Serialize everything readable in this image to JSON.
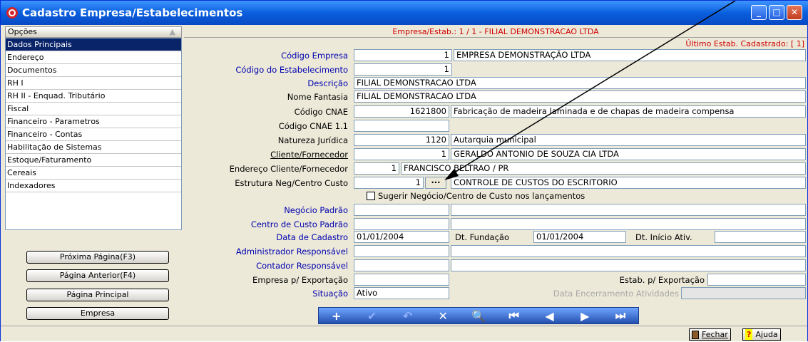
{
  "window": {
    "title": "Cadastro Empresa/Estabelecimentos",
    "min": "_",
    "max": "□",
    "close": "✕"
  },
  "sidebar": {
    "header": "Opções",
    "items": [
      {
        "label": "Dados Principais",
        "selected": true
      },
      {
        "label": "Endereço"
      },
      {
        "label": "Documentos"
      },
      {
        "label": "RH I"
      },
      {
        "label": "RH II - Enquad. Tributário"
      },
      {
        "label": "Fiscal"
      },
      {
        "label": "Financeiro - Parametros"
      },
      {
        "label": "Financeiro - Contas"
      },
      {
        "label": "Habilitação de Sistemas"
      },
      {
        "label": "Estoque/Faturamento"
      },
      {
        "label": "Cereais"
      },
      {
        "label": "Indexadores"
      }
    ],
    "buttons": {
      "next": "Próxima Página(F3)",
      "prev": "Página Anterior(F4)",
      "main": "Página Principal",
      "empresa": "Empresa"
    }
  },
  "header": {
    "title": "Empresa/Estab.: 1 / 1 - FILIAL DEMONSTRACAO LTDA",
    "ultimo": "Último Estab. Cadastrado: [ 1]"
  },
  "form": {
    "codigo_empresa": {
      "label": "Código Empresa",
      "value": "1",
      "desc": "EMPRESA DEMONSTRAÇÃO LTDA"
    },
    "codigo_estab": {
      "label": "Código do Estabelecimento",
      "value": "1"
    },
    "descricao": {
      "label": "Descrição",
      "value": "FILIAL DEMONSTRACAO LTDA"
    },
    "fantasia": {
      "label": "Nome Fantasia",
      "value": "FILIAL DEMONSTRACAO LTDA"
    },
    "cnae": {
      "label": "Código CNAE",
      "value": "1621800",
      "desc": "Fabricação de madeira laminada e de chapas de madeira compensa"
    },
    "cnae11": {
      "label": "Código CNAE 1.1",
      "value": ""
    },
    "natureza": {
      "label": "Natureza Jurídica",
      "value": "1120",
      "desc": "Autarquia municipal"
    },
    "cliente": {
      "label": "Cliente/Fornecedor",
      "value": "1",
      "desc": "GERALDO ANTONIO DE SOUZA CIA LTDA"
    },
    "endereco": {
      "label": "Endereço Cliente/Fornecedor",
      "value": "1",
      "desc": "FRANCISCO BELTRAO / PR"
    },
    "estrutura": {
      "label": "Estrutura Neg/Centro Custo",
      "value": "1",
      "btn": "···",
      "desc": "CONTROLE DE CUSTOS DO ESCRITORIO"
    },
    "sugerir": {
      "label": "Sugerir Negócio/Centro de Custo nos lançamentos"
    },
    "negocio": {
      "label": "Negócio Padrão"
    },
    "centro": {
      "label": "Centro de Custo Padrão"
    },
    "data_cadastro": {
      "label": "Data de Cadastro",
      "value": "01/01/2004"
    },
    "dt_fundacao": {
      "label": "Dt. Fundação",
      "value": "01/01/2004"
    },
    "dt_inicio": {
      "label": "Dt. Início Ativ.",
      "value": ""
    },
    "administrador": {
      "label": "Administrador Responsável"
    },
    "contador": {
      "label": "Contador Responsável"
    },
    "emp_export": {
      "label": "Empresa p/ Exportação"
    },
    "estab_export": {
      "label": "Estab. p/ Exportação"
    },
    "situacao": {
      "label": "Situação",
      "value": "Ativo"
    },
    "data_encerramento": {
      "label": "Data Encerramento Atividades"
    }
  },
  "toolbar": {
    "add": "+",
    "confirm": "✔",
    "undo": "↶",
    "cancel": "✕",
    "search": "🔍",
    "first": "⏮",
    "prev": "◀",
    "next": "▶",
    "last": "⏭"
  },
  "status": {
    "fechar": "Fechar",
    "ajuda": "Ajuda"
  }
}
